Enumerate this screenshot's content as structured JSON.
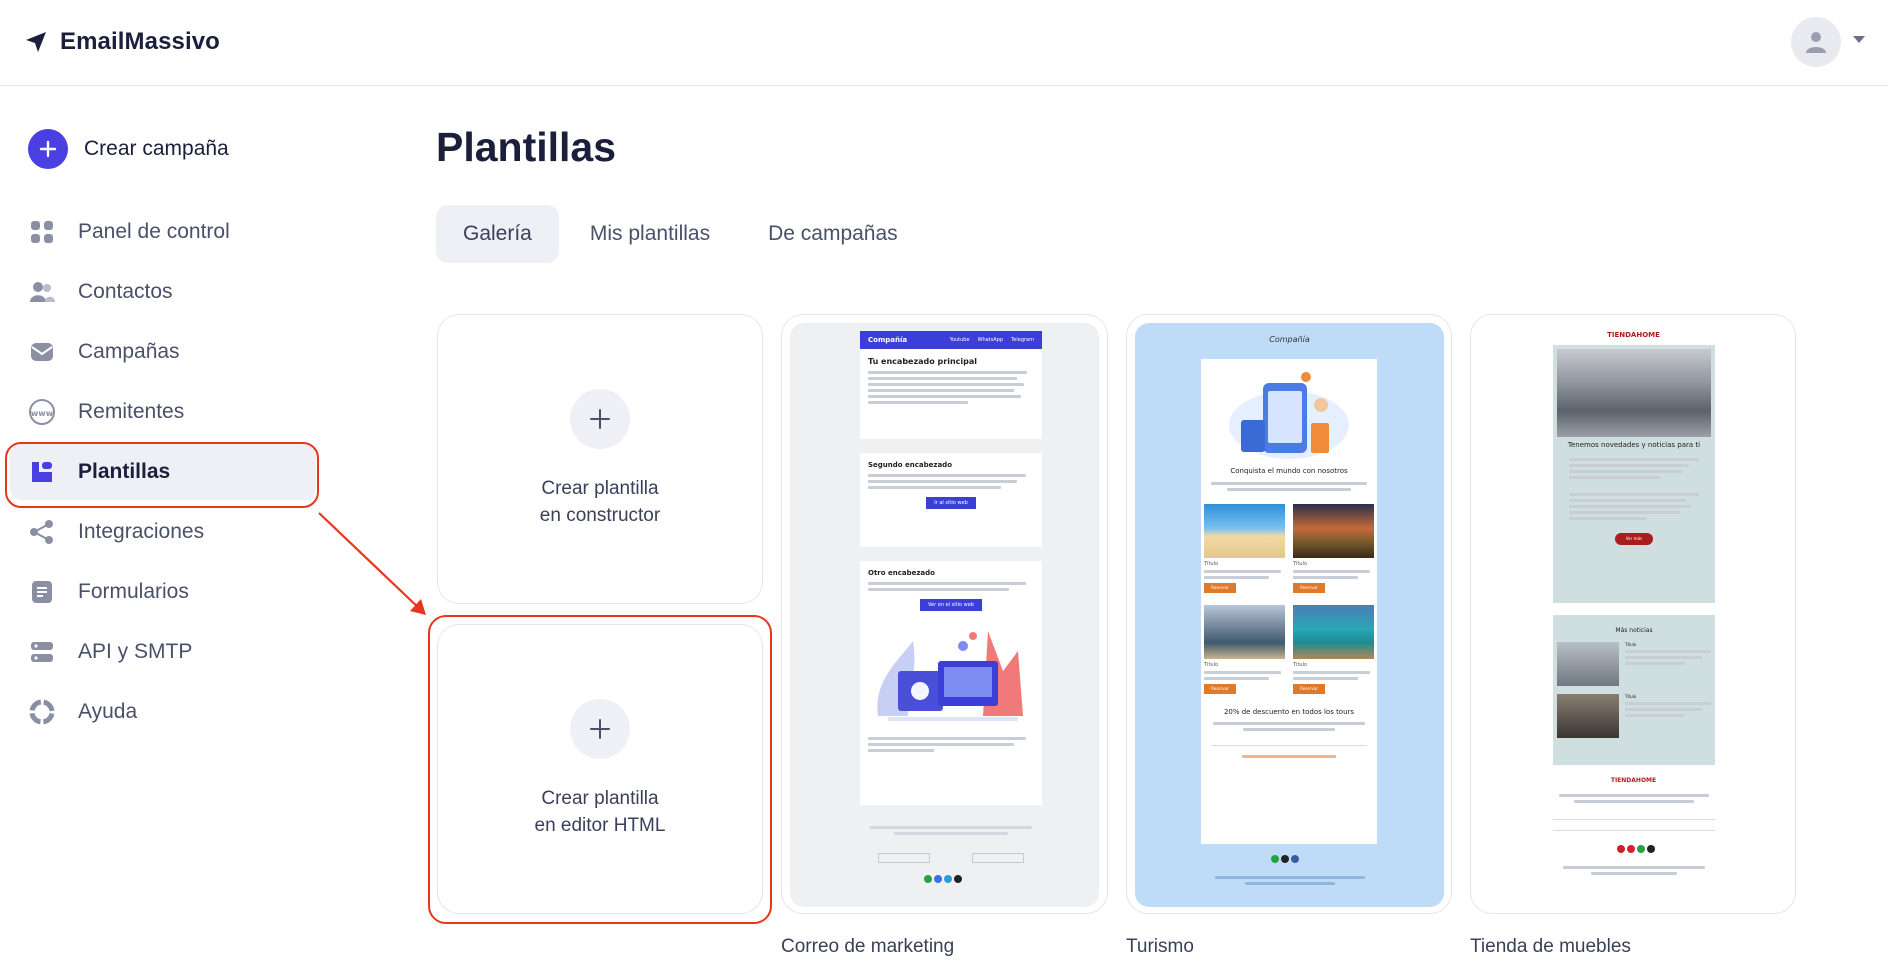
{
  "app": {
    "name": "EmailMassivo"
  },
  "sidebar": {
    "create_label": "Crear campaña",
    "items": [
      {
        "label": "Panel de control",
        "icon": "dashboard-icon"
      },
      {
        "label": "Contactos",
        "icon": "contacts-icon"
      },
      {
        "label": "Campañas",
        "icon": "campaigns-icon"
      },
      {
        "label": "Remitentes",
        "icon": "senders-icon"
      },
      {
        "label": "Plantillas",
        "icon": "templates-icon",
        "active": true
      },
      {
        "label": "Integraciones",
        "icon": "integrations-icon"
      },
      {
        "label": "Formularios",
        "icon": "forms-icon"
      },
      {
        "label": "API y SMTP",
        "icon": "api-icon"
      },
      {
        "label": "Ayuda",
        "icon": "help-icon"
      }
    ]
  },
  "main": {
    "title": "Plantillas",
    "tabs": [
      {
        "label": "Galería",
        "active": true
      },
      {
        "label": "Mis plantillas"
      },
      {
        "label": "De campañas"
      }
    ],
    "create_builder": {
      "line1": "Crear plantilla",
      "line2": "en constructor"
    },
    "create_html": {
      "line1": "Crear plantilla",
      "line2": "en editor HTML"
    },
    "templates": [
      {
        "name": "Correo de marketing",
        "preview": {
          "brand": "Compañía",
          "nav": [
            "Youtube",
            "WhatsApp",
            "Telegram"
          ],
          "heading1": "Tu encabezado principal",
          "heading2": "Segundo encabezado",
          "button1": "Ir al sitio web",
          "heading3": "Otro encabezado",
          "button2": "Ver en el sitio web"
        }
      },
      {
        "name": "Turismo",
        "preview": {
          "brand": "Compañía",
          "heading": "Conquista el mundo con nosotros",
          "item_title": "Título",
          "button": "Reservar",
          "discount": "20% de descuento en todos los tours"
        }
      },
      {
        "name": "Tienda de muebles",
        "preview": {
          "brand": "TIENDAHOME",
          "heading": "Tenemos novedades y noticias para ti",
          "button": "Ver más",
          "section": "Más noticias",
          "item_title": "Título"
        }
      }
    ]
  },
  "colors": {
    "accent": "#4a3fe0",
    "highlight": "#e8361c",
    "marketing_bg": "#eef0f2",
    "tourism_bg": "#bedcf8",
    "furniture_bg": "#cfdede"
  }
}
